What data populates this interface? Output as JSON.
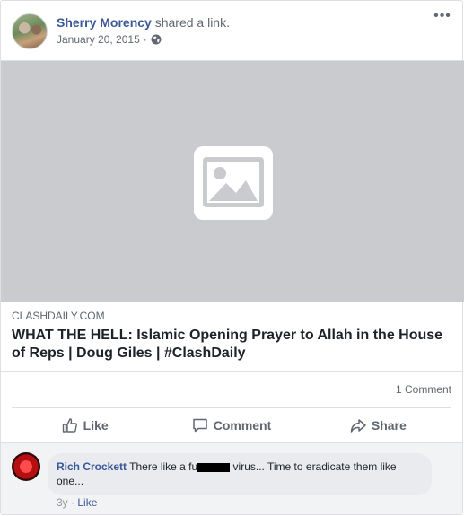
{
  "post": {
    "author": "Sherry Morency",
    "action": "shared a link.",
    "date": "January 20, 2015",
    "date_sep": "·",
    "privacy_icon": "globe-icon",
    "more_icon": "more-options-icon"
  },
  "link": {
    "domain": "CLASHDAILY.COM",
    "title": "WHAT THE HELL: Islamic Opening Prayer to Allah in the House of Reps | Doug Giles | #ClashDaily",
    "image_icon": "image-placeholder-icon"
  },
  "stats": {
    "comments": "1 Comment"
  },
  "actions": {
    "like": "Like",
    "comment": "Comment",
    "share": "Share"
  },
  "comment": {
    "author": "Rich Crockett",
    "text_before": "There like a fu",
    "text_after": " virus... Time to eradicate them like one...",
    "time": "3y",
    "sep": "·",
    "like": "Like"
  },
  "colors": {
    "link_blue": "#385898",
    "muted": "#606770",
    "placeholder": "#c9cbcf"
  }
}
